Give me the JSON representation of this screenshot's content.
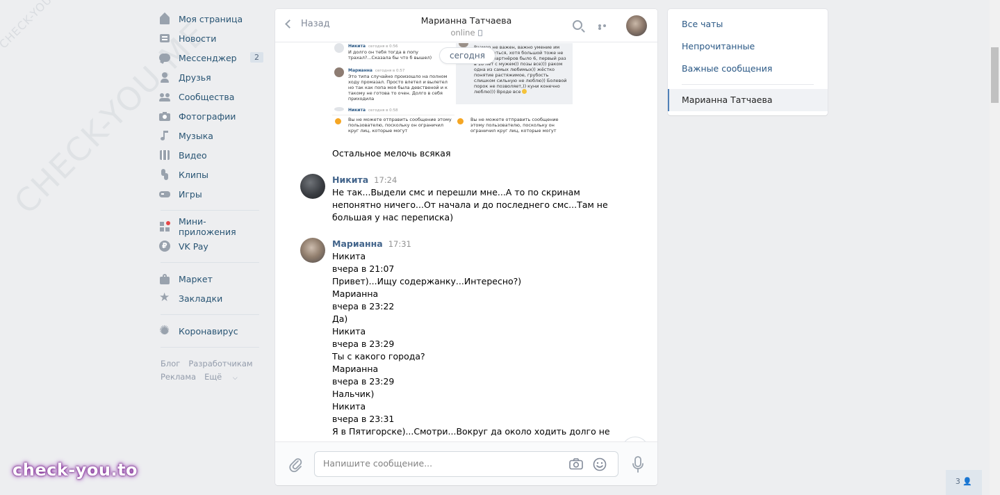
{
  "watermark": {
    "small": "CHECK-YOU.ME",
    "big": "CHECK-YOU.ME",
    "brand": "check-you.to"
  },
  "nav": {
    "main": [
      {
        "label": "Моя страница",
        "icon": "home-icon"
      },
      {
        "label": "Новости",
        "icon": "news-icon"
      },
      {
        "label": "Мессенджер",
        "icon": "messenger-icon",
        "badge": "2"
      },
      {
        "label": "Друзья",
        "icon": "friends-icon"
      },
      {
        "label": "Сообщества",
        "icon": "groups-icon"
      },
      {
        "label": "Фотографии",
        "icon": "camera-icon"
      },
      {
        "label": "Музыка",
        "icon": "music-icon"
      },
      {
        "label": "Видео",
        "icon": "video-icon"
      },
      {
        "label": "Клипы",
        "icon": "clips-icon"
      },
      {
        "label": "Игры",
        "icon": "games-icon"
      }
    ],
    "apps": [
      {
        "label": "Мини-приложения",
        "icon": "apps-icon"
      },
      {
        "label": "VK Pay",
        "icon": "vkpay-icon"
      }
    ],
    "shop": [
      {
        "label": "Маркет",
        "icon": "market-icon"
      },
      {
        "label": "Закладки",
        "icon": "star-icon"
      }
    ],
    "extra": [
      {
        "label": "Коронавирус",
        "icon": "virus-icon"
      }
    ],
    "footer": [
      "Блог",
      "Разработчикам",
      "Реклама",
      "Ещё"
    ]
  },
  "chat": {
    "back_label": "Назад",
    "peer_name": "Марианна Татчаева",
    "peer_status": "online",
    "day_label": "сегодня",
    "screenshot_left": {
      "msgs": [
        {
          "name": "Никита",
          "time": "сегодня в 0:56",
          "text": "И долго он тебя тогда в попу трахал?...Сказала бы что б вышел)"
        },
        {
          "name": "Марианна",
          "time": "сегодня в 0:57",
          "text": "Это типа случайно произошло на полном ходу промазал. Просто влетел и вылетел но так как попа моя была девственой и к такому не готова то очен. Долго в себя приходила"
        },
        {
          "name": "Никита",
          "time": "сегодня в 0:58",
          "text": ""
        }
      ],
      "warning": "Вы не можете отправить сообщение этому пользователю, поскольку он ограничил круг лиц, которые могут"
    },
    "screenshot_right": {
      "text": "Размер не важен, важно умение им пользоваться, хотя большой тоже не плохо)) партнёров было 6, первый раз в 18 лет с мужем)) позы все))) раком одна из самых любимых)) жёстко понятие растяжимое, грубость слишком сильную не люблю)) Болевой порок не позволяет,)) куни конечно люблю))) Вроде все",
      "warning": "Вы не можете отправить сообщение этому пользователю, поскольку он ограничил круг лиц, которые могут"
    },
    "caption": "Остальное мелочь всякая",
    "msg_nikita": {
      "author": "Никита",
      "time": "17:24",
      "lines": [
        "Не так...Выдели смс и перешли мне...А то по скринам",
        "непонятно ничего...От начала и до последнего смс...Там не",
        "большая у нас переписка)"
      ]
    },
    "msg_marianna": {
      "author": "Марианна",
      "time": "17:31",
      "lines": [
        "Никита",
        "вчера в 21:07",
        "Привет)...Ищу содержанку...Интересно?)",
        "Марианна",
        "вчера в 23:22",
        "Да)",
        "Никита",
        "вчера в 23:29",
        "Ты с какого города?",
        "Марианна",
        "вчера в 23:29",
        "Нальчик)",
        "Никита",
        "вчера в 23:31",
        "Я в Пятигорске)...Смотри...Вокруг да около ходить долго не"
      ]
    },
    "composer_placeholder": "Напишите сообщение..."
  },
  "right_panel": {
    "items": [
      "Все чаты",
      "Непрочитанные",
      "Важные сообщения"
    ],
    "active": "Марианна Татчаева"
  },
  "online_count": "3"
}
